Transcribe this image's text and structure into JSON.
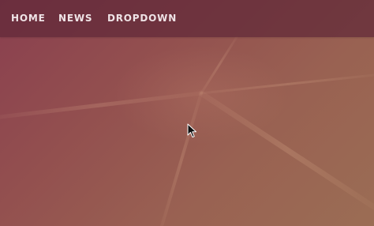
{
  "navbar": {
    "items": [
      {
        "label": "HOME"
      },
      {
        "label": "NEWS"
      },
      {
        "label": "DROPDOWN"
      }
    ]
  },
  "colors": {
    "navbar_background": "#5f2837",
    "nav_text": "#efe3e6",
    "background_start": "#8a3f4f",
    "background_end": "#9b6d54"
  },
  "icons": {
    "cursor": "mouse-pointer-icon"
  }
}
